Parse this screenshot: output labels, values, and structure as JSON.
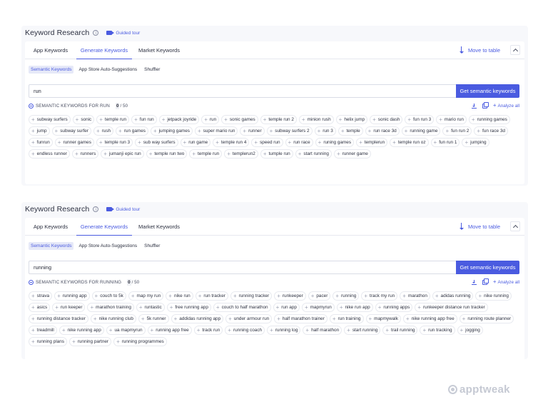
{
  "panels": [
    {
      "title": "Keyword Research",
      "guided_tour": "Guided tour",
      "tabs": [
        "App Keywords",
        "Generate Keywords",
        "Market Keywords"
      ],
      "active_tab": "Generate Keywords",
      "move_to_table": "Move to table",
      "subtabs": [
        "Semantic Keywords",
        "App Store Auto-Suggestions",
        "Shuffler"
      ],
      "active_subtab": "Semantic Keywords",
      "search_value": "run",
      "search_button": "Get semantic keywords",
      "keywords_label": "SEMANTIC KEYWORDS FOR RUN",
      "selected_count": "0",
      "total_count": "/ 50",
      "analyze_all": "Analyze all",
      "keywords": [
        "subway surfers",
        "sonic",
        "temple run",
        "fun run",
        "jetpack joyride",
        "run",
        "sonic games",
        "temple run 2",
        "minion rush",
        "helix jump",
        "sonic dash",
        "fun run 3",
        "mario run",
        "running games",
        "jump",
        "subway surfer",
        "rush",
        "run games",
        "jumping games",
        "super mario run",
        "runner",
        "subway surfers 2",
        "run 3",
        "temple",
        "run race 3d",
        "running game",
        "fun run 2",
        "fun race 3d",
        "funrun",
        "runner games",
        "temple run 3",
        "sub way surfers",
        "run game",
        "temple run 4",
        "speed run",
        "run race",
        "runing games",
        "templerun",
        "temple run oz",
        "fun run 1",
        "jumping",
        "endless runner",
        "runners",
        "jumanji epic run",
        "temple run two",
        "temple run",
        "templerun2",
        "tumple run",
        "start running",
        "runner game"
      ]
    },
    {
      "title": "Keyword Research",
      "guided_tour": "Guided tour",
      "tabs": [
        "App Keywords",
        "Generate Keywords",
        "Market Keywords"
      ],
      "active_tab": "Generate Keywords",
      "move_to_table": "Move to table",
      "subtabs": [
        "Semantic Keywords",
        "App Store Auto-Suggestions",
        "Shuffler"
      ],
      "active_subtab": "Semantic Keywords",
      "search_value": "running",
      "search_button": "Get semantic keywords",
      "keywords_label": "SEMANTIC KEYWORDS FOR RUNNING",
      "selected_count": "0",
      "total_count": "/ 50",
      "analyze_all": "Analyze all",
      "keywords": [
        "strava",
        "running app",
        "couch to 5k",
        "map my run",
        "nike run",
        "run tracker",
        "running tracker",
        "runkeeper",
        "pacer",
        "running",
        "track my run",
        "marathon",
        "adidas running",
        "nike running",
        "asics",
        "run keeper",
        "marathon training",
        "runtastic",
        "free running app",
        "couch to half marathon",
        "run app",
        "mapmyrun",
        "nike run app",
        "running apps",
        "runkeeper distance run tracker",
        "running distance tracker",
        "nike running club",
        "5k runner",
        "addidas running app",
        "under armour run",
        "half marathon trainer",
        "run training",
        "mapmywalk",
        "nike running app free",
        "running route planner",
        "treadmill",
        "nike running app",
        "ua mapmyrun",
        "running app free",
        "track run",
        "running coach",
        "running log",
        "half marathon",
        "start running",
        "trail running",
        "run tracking",
        "jogging",
        "running plans",
        "running partner",
        "running programmes"
      ]
    }
  ],
  "brand": "apptweak",
  "accent_color": "#4a5be0"
}
